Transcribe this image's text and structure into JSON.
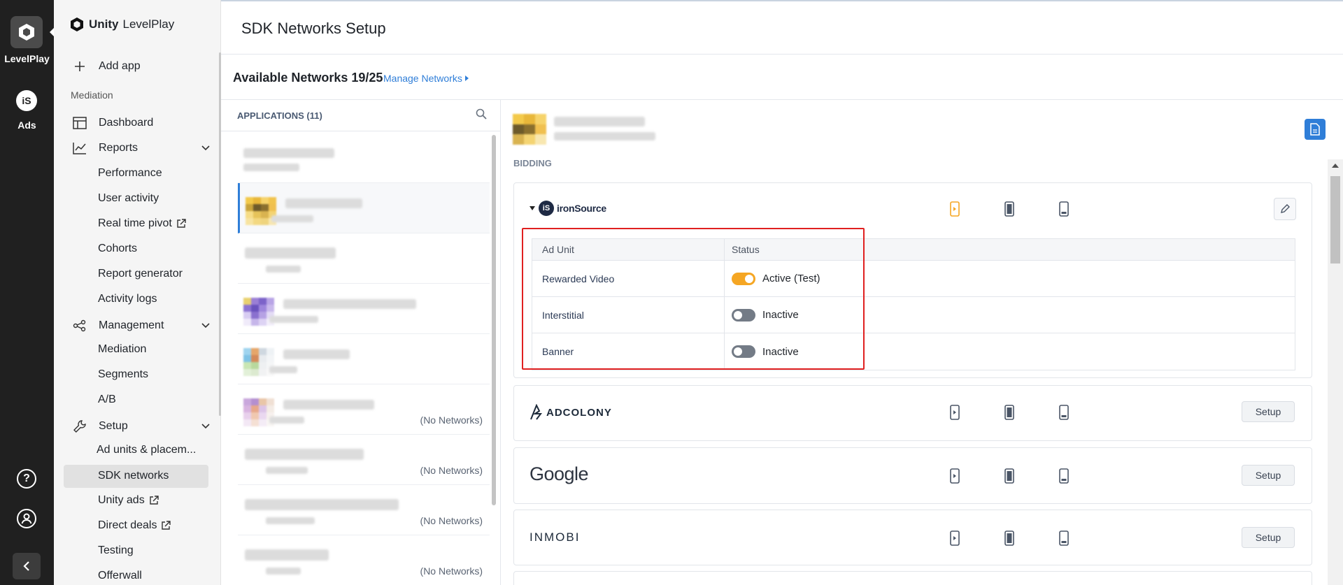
{
  "rail": {
    "product_label": "LevelPlay",
    "ads_label": "Ads",
    "ads_icon_text": "iS",
    "help_icon_text": "?"
  },
  "brand": {
    "bold": "Unity",
    "rest": "LevelPlay"
  },
  "nav": {
    "add_app": "Add app",
    "mediation_section": "Mediation",
    "dashboard": "Dashboard",
    "reports": "Reports",
    "reports_items": [
      "Performance",
      "User activity",
      "Real time pivot",
      "Cohorts",
      "Report generator",
      "Activity logs"
    ],
    "management": "Management",
    "management_items": [
      "Mediation",
      "Segments",
      "A/B"
    ],
    "setup": "Setup",
    "setup_items": [
      "Ad units & placem...",
      "SDK networks",
      "Unity ads",
      "Direct deals",
      "Testing",
      "Offerwall"
    ],
    "selected": "SDK networks"
  },
  "header": {
    "title": "SDK Networks Setup",
    "available": "Available Networks 19/25",
    "manage_link": "Manage Networks"
  },
  "apps": {
    "title": "APPLICATIONS (11)",
    "no_networks": "(No Networks)"
  },
  "detail": {
    "section": "BIDDING",
    "networks": [
      {
        "name": "ironSource",
        "logo_text": "ironSource",
        "expanded": true
      },
      {
        "name": "AdColony",
        "logo_text": "ADCOLONY",
        "action": "Setup"
      },
      {
        "name": "Google",
        "logo_text": "Google",
        "action": "Setup"
      },
      {
        "name": "InMobi",
        "logo_text": "INMOBI",
        "action": "Setup"
      }
    ],
    "table": {
      "col_unit": "Ad Unit",
      "col_status": "Status",
      "rows": [
        {
          "unit": "Rewarded Video",
          "status": "Active (Test)",
          "on": true
        },
        {
          "unit": "Interstitial",
          "status": "Inactive",
          "on": false
        },
        {
          "unit": "Banner",
          "status": "Inactive",
          "on": false
        }
      ]
    }
  },
  "colors": {
    "accent": "#2f7ed8",
    "active_toggle": "#f5a623",
    "highlight_box": "#e02020",
    "rail_bg": "#202020"
  }
}
